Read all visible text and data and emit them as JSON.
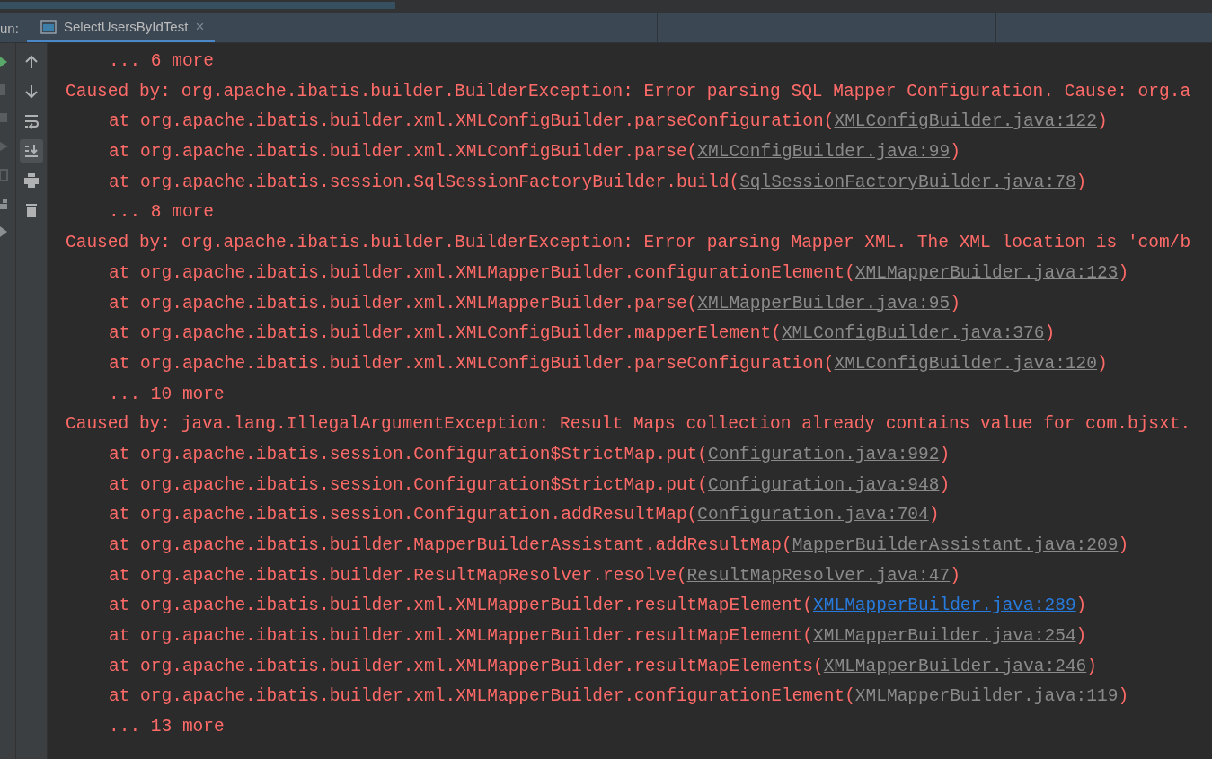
{
  "run_panel": {
    "label": "un:",
    "tabs": [
      {
        "title": "SelectUsersByIdTest",
        "close": "×",
        "selected": true
      }
    ]
  },
  "toolbar": {
    "tools": [
      {
        "kind": "up",
        "selected": false
      },
      {
        "kind": "down",
        "selected": false
      },
      {
        "kind": "wrap",
        "selected": false
      },
      {
        "kind": "scroll-end",
        "selected": true
      },
      {
        "kind": "print",
        "selected": false
      },
      {
        "kind": "trash",
        "selected": false
      }
    ]
  },
  "console": {
    "lines": [
      {
        "kind": "more",
        "text": "... 6 more"
      },
      {
        "kind": "caused",
        "text": "Caused by: org.apache.ibatis.builder.BuilderException: Error parsing SQL Mapper Configuration. Cause: org.a"
      },
      {
        "kind": "at",
        "text": "at org.apache.ibatis.builder.xml.XMLConfigBuilder.parseConfiguration(",
        "link": "XMLConfigBuilder.java:122",
        "suffix": ")",
        "highlighted": false
      },
      {
        "kind": "at",
        "text": "at org.apache.ibatis.builder.xml.XMLConfigBuilder.parse(",
        "link": "XMLConfigBuilder.java:99",
        "suffix": ")",
        "highlighted": false
      },
      {
        "kind": "at",
        "text": "at org.apache.ibatis.session.SqlSessionFactoryBuilder.build(",
        "link": "SqlSessionFactoryBuilder.java:78",
        "suffix": ")",
        "highlighted": false
      },
      {
        "kind": "more",
        "text": "... 8 more"
      },
      {
        "kind": "caused",
        "text": "Caused by: org.apache.ibatis.builder.BuilderException: Error parsing Mapper XML. The XML location is 'com/b"
      },
      {
        "kind": "at",
        "text": "at org.apache.ibatis.builder.xml.XMLMapperBuilder.configurationElement(",
        "link": "XMLMapperBuilder.java:123",
        "suffix": ")",
        "highlighted": false
      },
      {
        "kind": "at",
        "text": "at org.apache.ibatis.builder.xml.XMLMapperBuilder.parse(",
        "link": "XMLMapperBuilder.java:95",
        "suffix": ")",
        "highlighted": false
      },
      {
        "kind": "at",
        "text": "at org.apache.ibatis.builder.xml.XMLConfigBuilder.mapperElement(",
        "link": "XMLConfigBuilder.java:376",
        "suffix": ")",
        "highlighted": false
      },
      {
        "kind": "at",
        "text": "at org.apache.ibatis.builder.xml.XMLConfigBuilder.parseConfiguration(",
        "link": "XMLConfigBuilder.java:120",
        "suffix": ")",
        "highlighted": false
      },
      {
        "kind": "more",
        "text": "... 10 more"
      },
      {
        "kind": "caused",
        "text": "Caused by: java.lang.IllegalArgumentException: Result Maps collection already contains value for com.bjsxt."
      },
      {
        "kind": "at",
        "text": "at org.apache.ibatis.session.Configuration$StrictMap.put(",
        "link": "Configuration.java:992",
        "suffix": ")",
        "highlighted": false
      },
      {
        "kind": "at",
        "text": "at org.apache.ibatis.session.Configuration$StrictMap.put(",
        "link": "Configuration.java:948",
        "suffix": ")",
        "highlighted": false
      },
      {
        "kind": "at",
        "text": "at org.apache.ibatis.session.Configuration.addResultMap(",
        "link": "Configuration.java:704",
        "suffix": ")",
        "highlighted": false
      },
      {
        "kind": "at",
        "text": "at org.apache.ibatis.builder.MapperBuilderAssistant.addResultMap(",
        "link": "MapperBuilderAssistant.java:209",
        "suffix": ")",
        "highlighted": false
      },
      {
        "kind": "at",
        "text": "at org.apache.ibatis.builder.ResultMapResolver.resolve(",
        "link": "ResultMapResolver.java:47",
        "suffix": ")",
        "highlighted": false
      },
      {
        "kind": "at",
        "text": "at org.apache.ibatis.builder.xml.XMLMapperBuilder.resultMapElement(",
        "link": "XMLMapperBuilder.java:289",
        "suffix": ")",
        "highlighted": true
      },
      {
        "kind": "at",
        "text": "at org.apache.ibatis.builder.xml.XMLMapperBuilder.resultMapElement(",
        "link": "XMLMapperBuilder.java:254",
        "suffix": ")",
        "highlighted": false
      },
      {
        "kind": "at",
        "text": "at org.apache.ibatis.builder.xml.XMLMapperBuilder.resultMapElements(",
        "link": "XMLMapperBuilder.java:246",
        "suffix": ")",
        "highlighted": false
      },
      {
        "kind": "at",
        "text": "at org.apache.ibatis.builder.xml.XMLMapperBuilder.configurationElement(",
        "link": "XMLMapperBuilder.java:119",
        "suffix": ")",
        "highlighted": false
      },
      {
        "kind": "more",
        "text": "... 13 more"
      }
    ]
  }
}
